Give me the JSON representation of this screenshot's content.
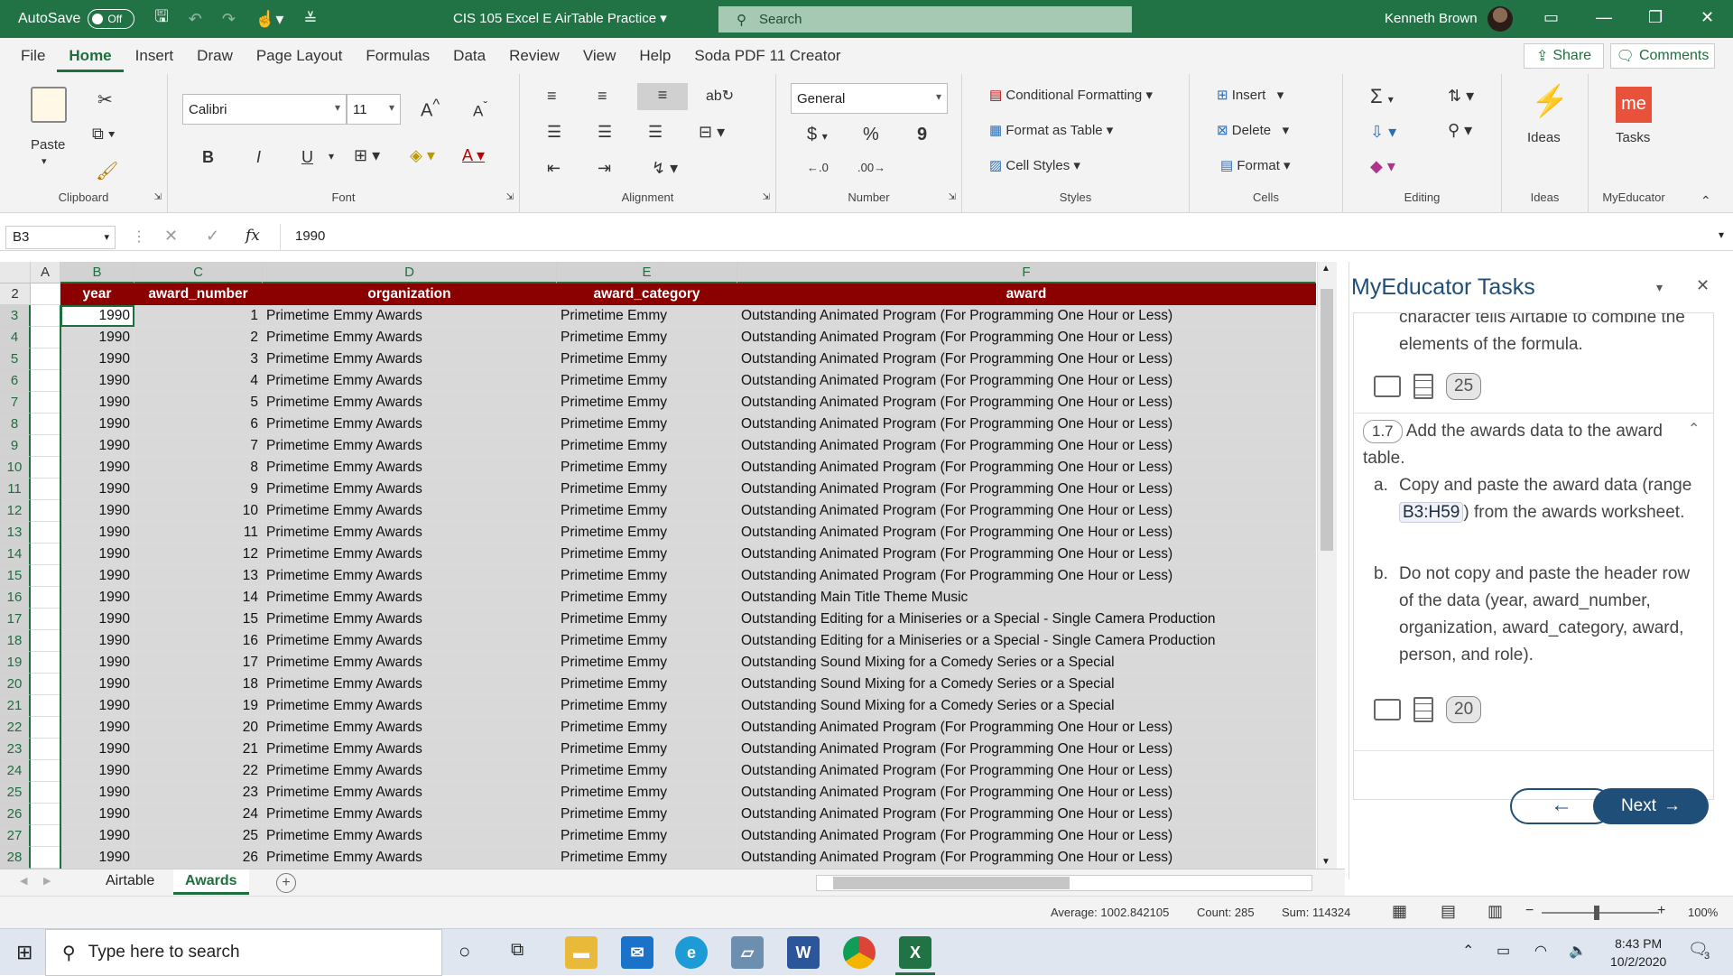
{
  "titlebar": {
    "autosave_label": "AutoSave",
    "autosave_state": "Off",
    "doc_title": "CIS 105 Excel E AirTable Practice",
    "search_placeholder": "Search",
    "user_name": "Kenneth Brown",
    "accent": "#217346"
  },
  "menu": {
    "items": [
      "File",
      "Home",
      "Insert",
      "Draw",
      "Page Layout",
      "Formulas",
      "Data",
      "Review",
      "View",
      "Help",
      "Soda PDF 11 Creator"
    ],
    "active": "Home",
    "share": "Share",
    "comments": "Comments"
  },
  "ribbon": {
    "clipboard": {
      "paste": "Paste",
      "label": "Clipboard"
    },
    "font": {
      "name": "Calibri",
      "size": "11",
      "bold": "B",
      "italic": "I",
      "underline": "U",
      "label": "Font"
    },
    "alignment": {
      "label": "Alignment"
    },
    "number": {
      "format": "General",
      "currency": "$",
      "percent": "%",
      "comma": "9",
      "label": "Number"
    },
    "styles": {
      "conditional": "Conditional Formatting",
      "format_table": "Format as Table",
      "cell_styles": "Cell Styles",
      "label": "Styles"
    },
    "cells": {
      "insert": "Insert",
      "delete": "Delete",
      "format": "Format",
      "label": "Cells"
    },
    "editing": {
      "label": "Editing"
    },
    "ideas": {
      "button": "Ideas",
      "label": "Ideas"
    },
    "myeducator": {
      "button": "Tasks",
      "logo": "me",
      "label": "MyEducator"
    }
  },
  "formula_bar": {
    "name_box": "B3",
    "fx": "fx",
    "value": "1990"
  },
  "columns": [
    "A",
    "B",
    "C",
    "D",
    "E",
    "F"
  ],
  "header_row": {
    "row": "2",
    "cells": [
      "year",
      "award_number",
      "organization",
      "award_category",
      "award"
    ]
  },
  "rows": [
    {
      "row": "3",
      "year": "1990",
      "num": "1",
      "org": "Primetime Emmy Awards",
      "cat": "Primetime Emmy",
      "award": "Outstanding Animated Program (For Programming One Hour or Less)"
    },
    {
      "row": "4",
      "year": "1990",
      "num": "2",
      "org": "Primetime Emmy Awards",
      "cat": "Primetime Emmy",
      "award": "Outstanding Animated Program (For Programming One Hour or Less)"
    },
    {
      "row": "5",
      "year": "1990",
      "num": "3",
      "org": "Primetime Emmy Awards",
      "cat": "Primetime Emmy",
      "award": "Outstanding Animated Program (For Programming One Hour or Less)"
    },
    {
      "row": "6",
      "year": "1990",
      "num": "4",
      "org": "Primetime Emmy Awards",
      "cat": "Primetime Emmy",
      "award": "Outstanding Animated Program (For Programming One Hour or Less)"
    },
    {
      "row": "7",
      "year": "1990",
      "num": "5",
      "org": "Primetime Emmy Awards",
      "cat": "Primetime Emmy",
      "award": "Outstanding Animated Program (For Programming One Hour or Less)"
    },
    {
      "row": "8",
      "year": "1990",
      "num": "6",
      "org": "Primetime Emmy Awards",
      "cat": "Primetime Emmy",
      "award": "Outstanding Animated Program (For Programming One Hour or Less)"
    },
    {
      "row": "9",
      "year": "1990",
      "num": "7",
      "org": "Primetime Emmy Awards",
      "cat": "Primetime Emmy",
      "award": "Outstanding Animated Program (For Programming One Hour or Less)"
    },
    {
      "row": "10",
      "year": "1990",
      "num": "8",
      "org": "Primetime Emmy Awards",
      "cat": "Primetime Emmy",
      "award": "Outstanding Animated Program (For Programming One Hour or Less)"
    },
    {
      "row": "11",
      "year": "1990",
      "num": "9",
      "org": "Primetime Emmy Awards",
      "cat": "Primetime Emmy",
      "award": "Outstanding Animated Program (For Programming One Hour or Less)"
    },
    {
      "row": "12",
      "year": "1990",
      "num": "10",
      "org": "Primetime Emmy Awards",
      "cat": "Primetime Emmy",
      "award": "Outstanding Animated Program (For Programming One Hour or Less)"
    },
    {
      "row": "13",
      "year": "1990",
      "num": "11",
      "org": "Primetime Emmy Awards",
      "cat": "Primetime Emmy",
      "award": "Outstanding Animated Program (For Programming One Hour or Less)"
    },
    {
      "row": "14",
      "year": "1990",
      "num": "12",
      "org": "Primetime Emmy Awards",
      "cat": "Primetime Emmy",
      "award": "Outstanding Animated Program (For Programming One Hour or Less)"
    },
    {
      "row": "15",
      "year": "1990",
      "num": "13",
      "org": "Primetime Emmy Awards",
      "cat": "Primetime Emmy",
      "award": "Outstanding Animated Program (For Programming One Hour or Less)"
    },
    {
      "row": "16",
      "year": "1990",
      "num": "14",
      "org": "Primetime Emmy Awards",
      "cat": "Primetime Emmy",
      "award": "Outstanding Main Title Theme Music"
    },
    {
      "row": "17",
      "year": "1990",
      "num": "15",
      "org": "Primetime Emmy Awards",
      "cat": "Primetime Emmy",
      "award": "Outstanding Editing for a Miniseries or a Special - Single Camera Production"
    },
    {
      "row": "18",
      "year": "1990",
      "num": "16",
      "org": "Primetime Emmy Awards",
      "cat": "Primetime Emmy",
      "award": "Outstanding Editing for a Miniseries or a Special - Single Camera Production"
    },
    {
      "row": "19",
      "year": "1990",
      "num": "17",
      "org": "Primetime Emmy Awards",
      "cat": "Primetime Emmy",
      "award": "Outstanding Sound Mixing for a Comedy Series or a Special"
    },
    {
      "row": "20",
      "year": "1990",
      "num": "18",
      "org": "Primetime Emmy Awards",
      "cat": "Primetime Emmy",
      "award": "Outstanding Sound Mixing for a Comedy Series or a Special"
    },
    {
      "row": "21",
      "year": "1990",
      "num": "19",
      "org": "Primetime Emmy Awards",
      "cat": "Primetime Emmy",
      "award": "Outstanding Sound Mixing for a Comedy Series or a Special"
    },
    {
      "row": "22",
      "year": "1990",
      "num": "20",
      "org": "Primetime Emmy Awards",
      "cat": "Primetime Emmy",
      "award": "Outstanding Animated Program (For Programming One Hour or Less)"
    },
    {
      "row": "23",
      "year": "1990",
      "num": "21",
      "org": "Primetime Emmy Awards",
      "cat": "Primetime Emmy",
      "award": "Outstanding Animated Program (For Programming One Hour or Less)"
    },
    {
      "row": "24",
      "year": "1990",
      "num": "22",
      "org": "Primetime Emmy Awards",
      "cat": "Primetime Emmy",
      "award": "Outstanding Animated Program (For Programming One Hour or Less)"
    },
    {
      "row": "25",
      "year": "1990",
      "num": "23",
      "org": "Primetime Emmy Awards",
      "cat": "Primetime Emmy",
      "award": "Outstanding Animated Program (For Programming One Hour or Less)"
    },
    {
      "row": "26",
      "year": "1990",
      "num": "24",
      "org": "Primetime Emmy Awards",
      "cat": "Primetime Emmy",
      "award": "Outstanding Animated Program (For Programming One Hour or Less)"
    },
    {
      "row": "27",
      "year": "1990",
      "num": "25",
      "org": "Primetime Emmy Awards",
      "cat": "Primetime Emmy",
      "award": "Outstanding Animated Program (For Programming One Hour or Less)"
    },
    {
      "row": "28",
      "year": "1990",
      "num": "26",
      "org": "Primetime Emmy Awards",
      "cat": "Primetime Emmy",
      "award": "Outstanding Animated Program (For Programming One Hour or Less)"
    }
  ],
  "sheets": {
    "tabs": [
      "Airtable",
      "Awards"
    ],
    "active": "Awards"
  },
  "status": {
    "average": "Average: 1002.842105",
    "count": "Count: 285",
    "sum": "Sum: 114324",
    "zoom": "100%"
  },
  "task_pane": {
    "title": "MyEducator Tasks",
    "partial_text": "character tells Airtable to combine the elements of the formula.",
    "badge_prev": "25",
    "step_number": "1.7",
    "step_title": "Add the awards data to the award table.",
    "item_a_marker": "a.",
    "item_a_pre": "Copy and paste the award data (range ",
    "item_a_code": "B3:H59",
    "item_a_post": ") from the awards worksheet.",
    "item_b_marker": "b.",
    "item_b": "Do not copy and paste the header row of the data (year, award_number, organization, award_category, award, person, and role).",
    "badge_step": "20",
    "back": "←",
    "next": "Next",
    "accent": "#1f4e79"
  },
  "taskbar": {
    "search_placeholder": "Type here to search",
    "time": "8:43 PM",
    "date": "10/2/2020",
    "notifications": "3"
  }
}
